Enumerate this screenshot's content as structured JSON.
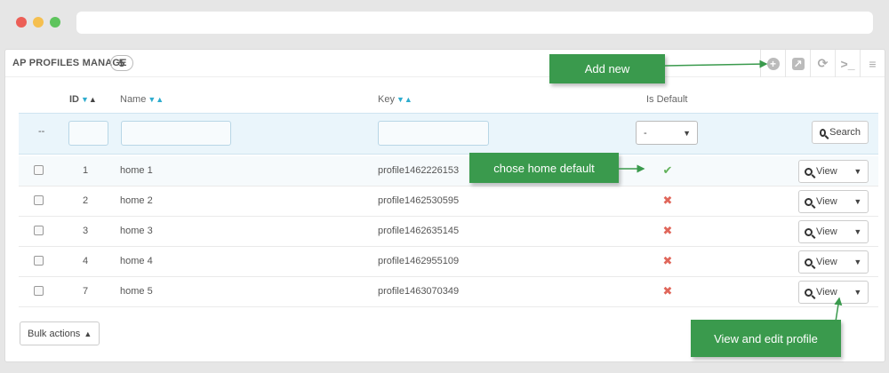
{
  "panel": {
    "title": "AP PROFILES MANAGE",
    "count": "5",
    "toolbar": [
      {
        "icon": "add-icon",
        "glyph": "+"
      },
      {
        "icon": "export-icon",
        "glyph": "↗"
      },
      {
        "icon": "refresh-icon",
        "glyph": "⟳"
      },
      {
        "icon": "sql-query-icon",
        "glyph": ">_"
      },
      {
        "icon": "database-icon",
        "glyph": "≡"
      }
    ]
  },
  "table": {
    "headers": {
      "id": "ID",
      "name": "Name",
      "key": "Key",
      "is_default": "Is Default"
    },
    "filter": {
      "reset": "--",
      "default_select": "-",
      "search_label": "Search"
    },
    "rows": [
      {
        "id": "1",
        "name": "home 1",
        "key": "profile1462226153",
        "is_default": true
      },
      {
        "id": "2",
        "name": "home 2",
        "key": "profile1462530595",
        "is_default": false
      },
      {
        "id": "3",
        "name": "home 3",
        "key": "profile1462635145",
        "is_default": false
      },
      {
        "id": "4",
        "name": "home 4",
        "key": "profile1462955109",
        "is_default": false
      },
      {
        "id": "7",
        "name": "home 5",
        "key": "profile1463070349",
        "is_default": false
      }
    ],
    "view_label": "View"
  },
  "bulk_actions_label": "Bulk actions",
  "annotations": {
    "add_new": "Add new",
    "chose_home_default": "chose home default",
    "view_and_edit": "View and edit profile"
  },
  "colors": {
    "annotation": "#3a9a4d",
    "check": "#62b25a",
    "cross": "#e0665a",
    "filter_bg": "#eaf5fb",
    "sort_arrow": "#2eacce"
  }
}
